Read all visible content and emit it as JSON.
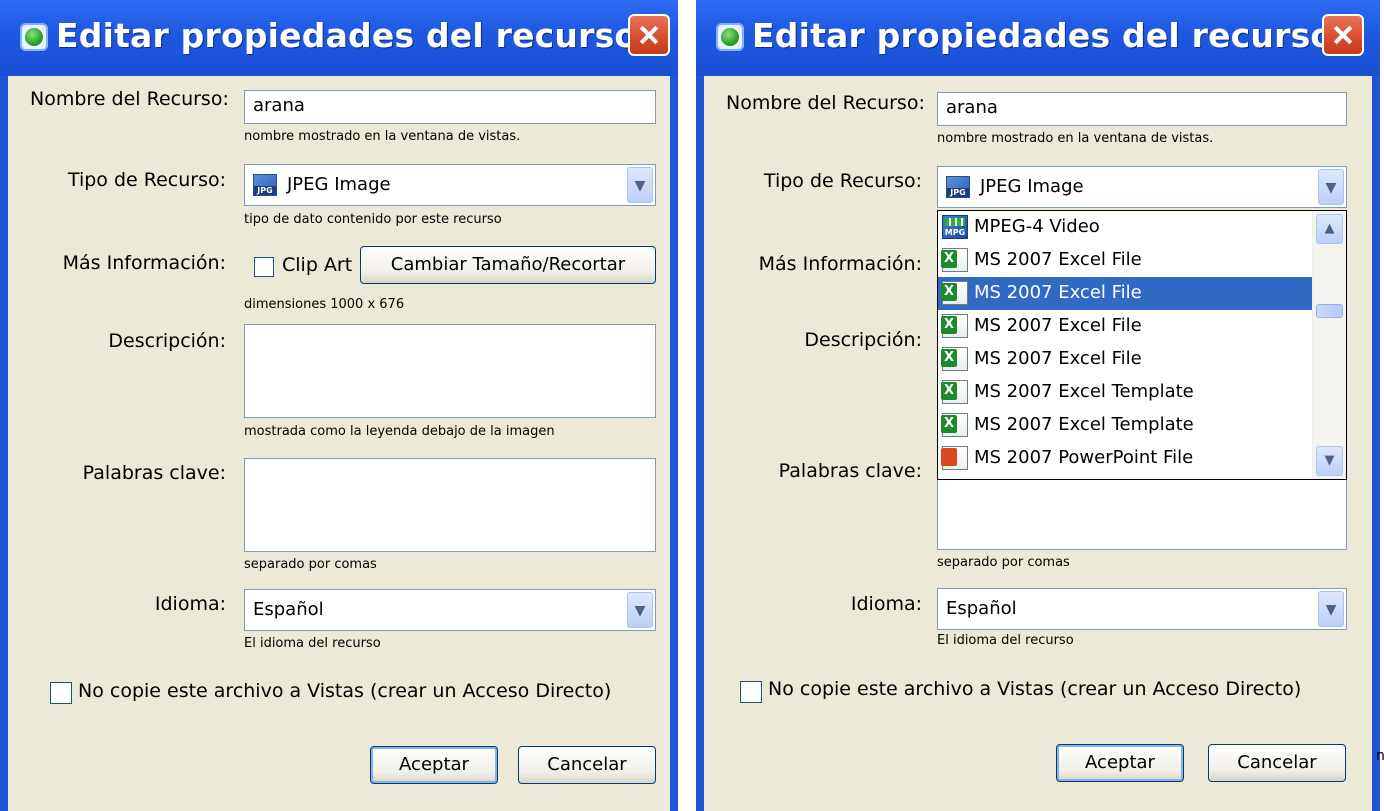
{
  "dialog_left": {
    "title": "Editar propiedades del recurso",
    "fields": {
      "name_label": "Nombre del Recurso:",
      "name_value": "arana",
      "name_hint": "nombre mostrado en la ventana de vistas.",
      "type_label": "Tipo de Recurso:",
      "type_value": "JPEG Image",
      "type_hint": "tipo de dato contenido por este recurso",
      "more_label": "Más Información:",
      "clipart_label": "Clip Art",
      "resize_button": "Cambiar Tamaño/Recortar",
      "dimensions": "dimensiones 1000 x 676",
      "desc_label": "Descripción:",
      "desc_value": "",
      "desc_hint": "mostrada como la leyenda debajo de la imagen",
      "keywords_label": "Palabras clave:",
      "keywords_value": "",
      "keywords_hint": "separado por comas",
      "lang_label": "Idioma:",
      "lang_value": "Español",
      "lang_hint": "El idioma del recurso",
      "nocopy_label": "No copie este archivo a Vistas (crear un Acceso Directo)"
    },
    "buttons": {
      "ok": "Aceptar",
      "cancel": "Cancelar"
    }
  },
  "dialog_right": {
    "title": "Editar propiedades del recurso",
    "fields": {
      "name_label": "Nombre del Recurso:",
      "name_value": "arana",
      "name_hint": "nombre mostrado en la ventana de vistas.",
      "type_label": "Tipo de Recurso:",
      "type_value": "JPEG Image",
      "more_label": "Más Información:",
      "desc_label": "Descripción:",
      "keywords_label": "Palabras clave:",
      "keywords_hint": "separado por comas",
      "lang_label": "Idioma:",
      "lang_value": "Español",
      "lang_hint": "El idioma del recurso",
      "nocopy_label": "No copie este archivo a Vistas (crear un Acceso Directo)"
    },
    "dropdown": {
      "items": [
        {
          "label": "MPEG-4 Video",
          "icon": "mpeg-video-icon"
        },
        {
          "label": "MS 2007 Excel File",
          "icon": "excel-file-icon"
        },
        {
          "label": "MS 2007 Excel File",
          "icon": "excel-file-icon",
          "selected": true
        },
        {
          "label": "MS 2007 Excel File",
          "icon": "excel-file-icon"
        },
        {
          "label": "MS 2007 Excel File",
          "icon": "excel-file-icon"
        },
        {
          "label": "MS 2007 Excel Template",
          "icon": "excel-file-icon"
        },
        {
          "label": "MS 2007 Excel Template",
          "icon": "excel-file-icon"
        },
        {
          "label": "MS 2007 PowerPoint File",
          "icon": "powerpoint-file-icon"
        }
      ]
    },
    "buttons": {
      "ok": "Aceptar",
      "cancel": "Cancelar"
    }
  },
  "stray_glyph": "n",
  "colors": {
    "titlebar": "#1f55d6",
    "client_bg": "#ece9d8",
    "selection": "#316ac5",
    "close_button": "#d64b2a"
  }
}
